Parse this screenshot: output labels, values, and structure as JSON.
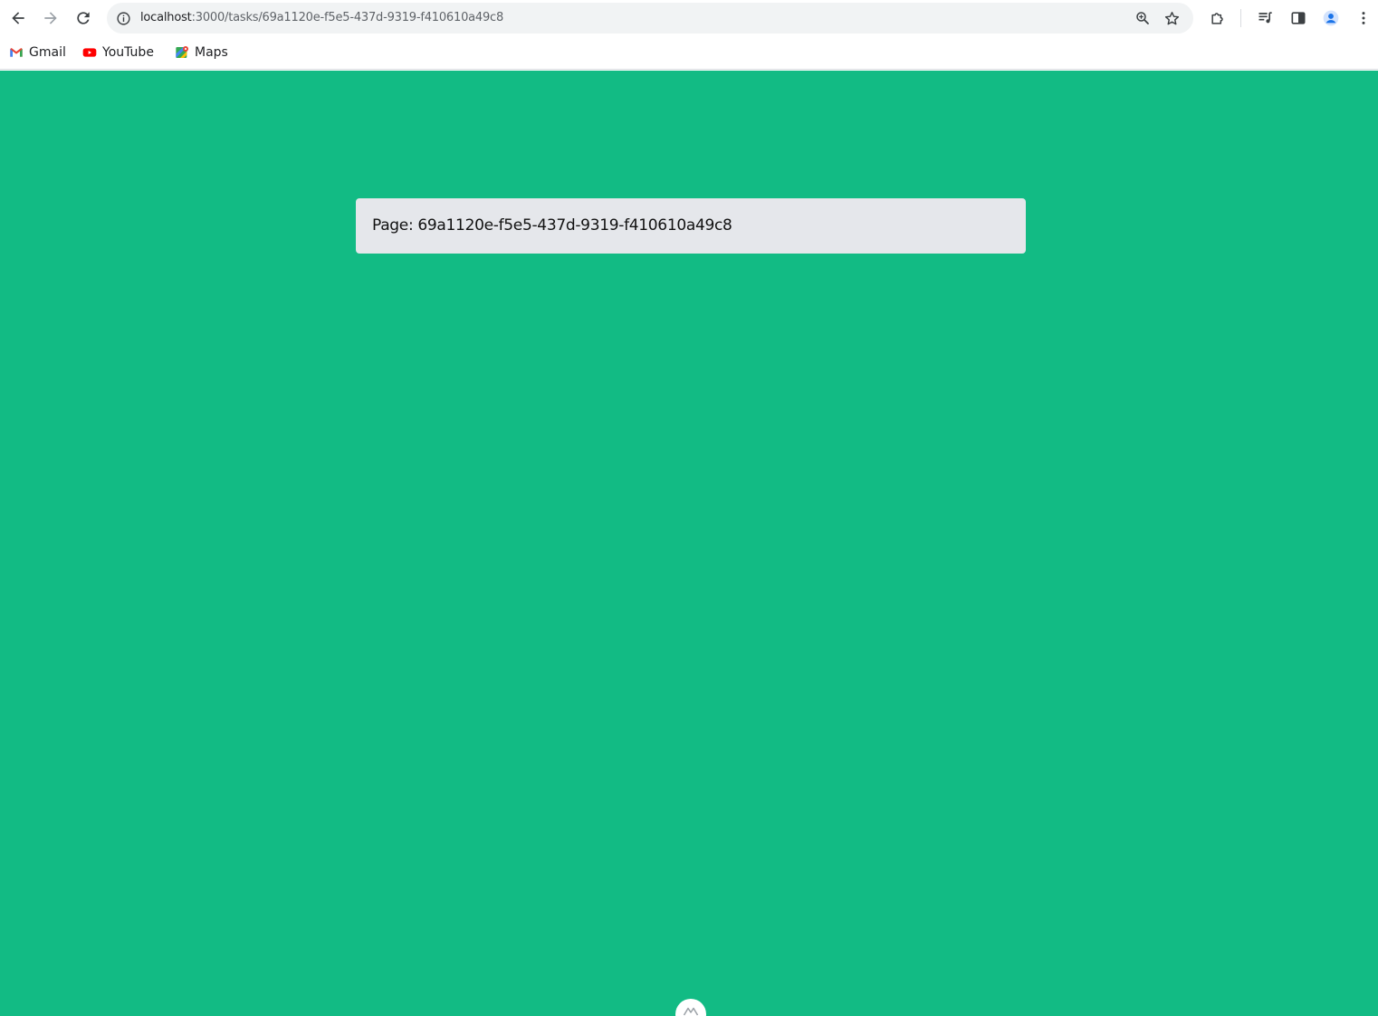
{
  "browser": {
    "url_host": "localhost",
    "url_path": ":3000/tasks/69a1120e-f5e5-437d-9319-f410610a49c8",
    "icons": {
      "back": "arrow-left-icon",
      "forward": "arrow-right-icon",
      "reload": "reload-icon",
      "site_info": "info-icon",
      "zoom": "zoom-icon",
      "bookmark": "star-icon",
      "extensions": "puzzle-icon",
      "media": "media-control-icon",
      "side_panel": "side-panel-icon",
      "profile": "profile-avatar-icon",
      "menu": "kebab-menu-icon"
    }
  },
  "bookmarks": [
    {
      "label": "Gmail",
      "icon": "gmail-icon"
    },
    {
      "label": "YouTube",
      "icon": "youtube-icon"
    },
    {
      "label": "Maps",
      "icon": "maps-icon"
    }
  ],
  "page": {
    "background_color": "#12bb84",
    "card_prefix": "Page:",
    "card_id": "69a1120e-f5e5-437d-9319-f410610a49c8",
    "card_color": "#e5e7eb"
  }
}
